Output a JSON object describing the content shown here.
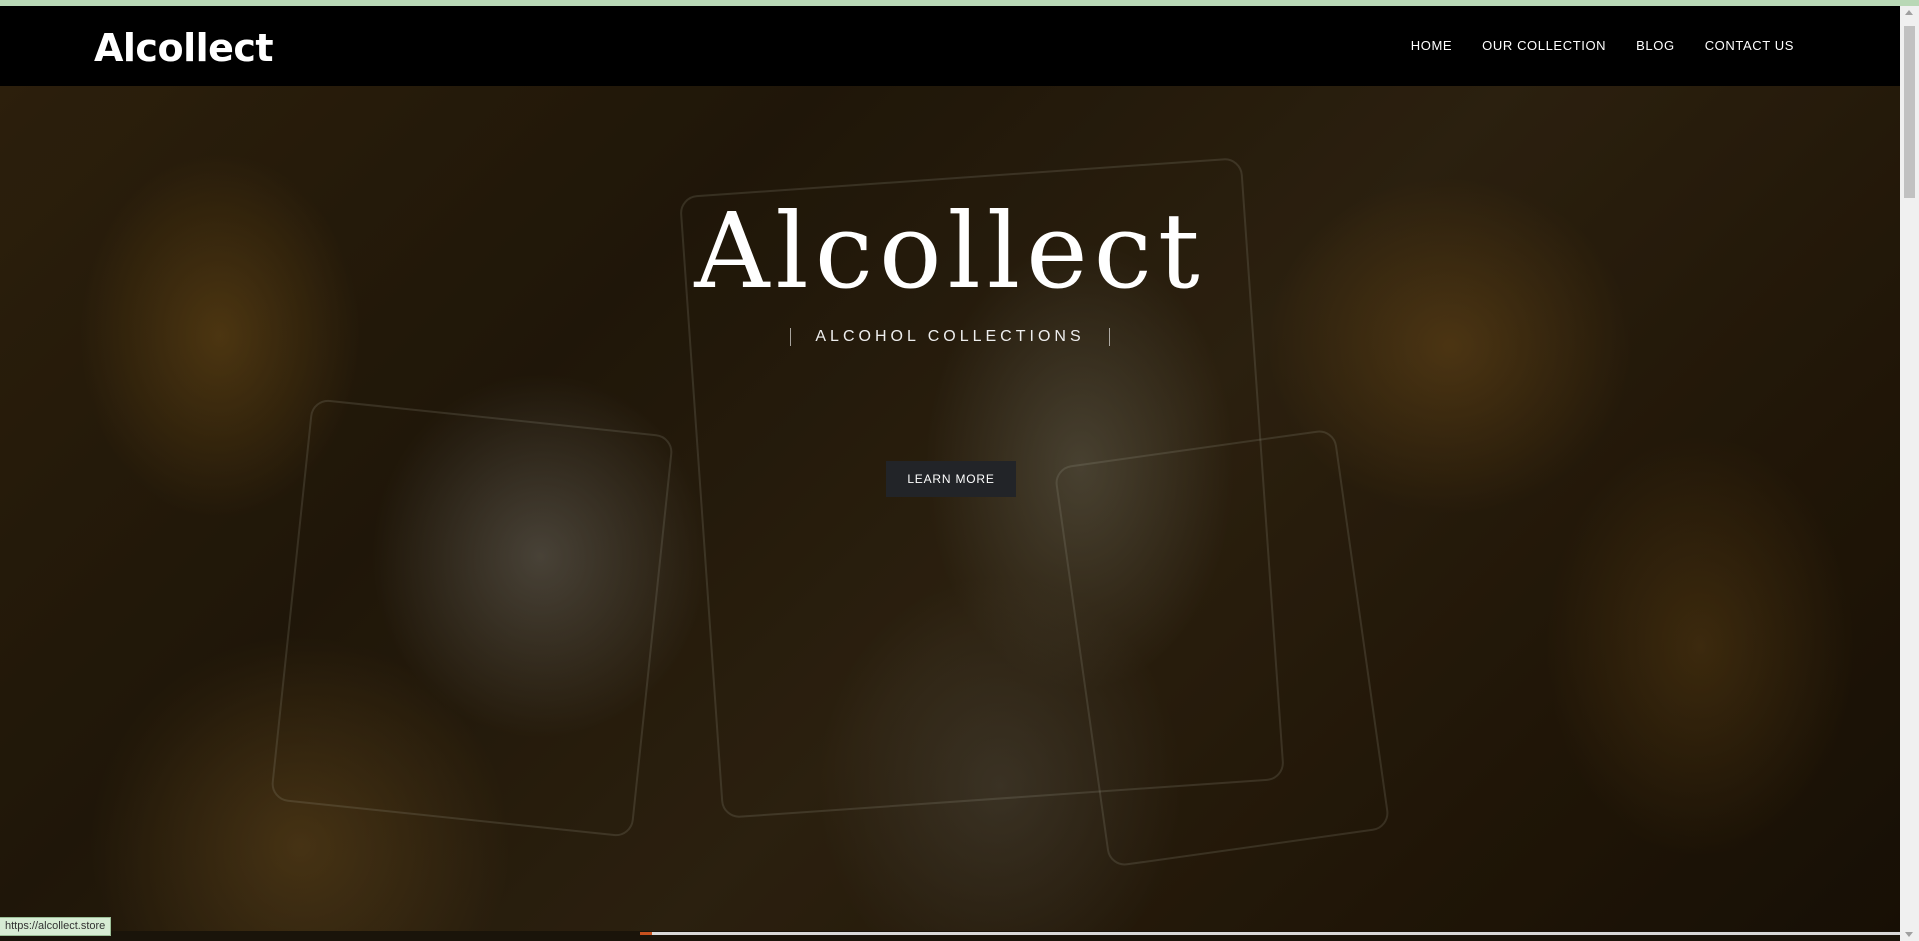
{
  "site": {
    "brand": "Alcollect"
  },
  "nav": {
    "items": [
      {
        "label": "HOME"
      },
      {
        "label": "OUR COLLECTION"
      },
      {
        "label": "BLOG"
      },
      {
        "label": "CONTACT US"
      }
    ]
  },
  "hero": {
    "title": "Alcollect",
    "tagline": "ALCOHOL COLLECTIONS",
    "cta_label": "LEARN MORE"
  },
  "status_bar": {
    "url": "https://alcollect.store"
  },
  "colors": {
    "navbar": "#000000",
    "button": "#222428",
    "accent_strip": "#b9d8b6"
  }
}
